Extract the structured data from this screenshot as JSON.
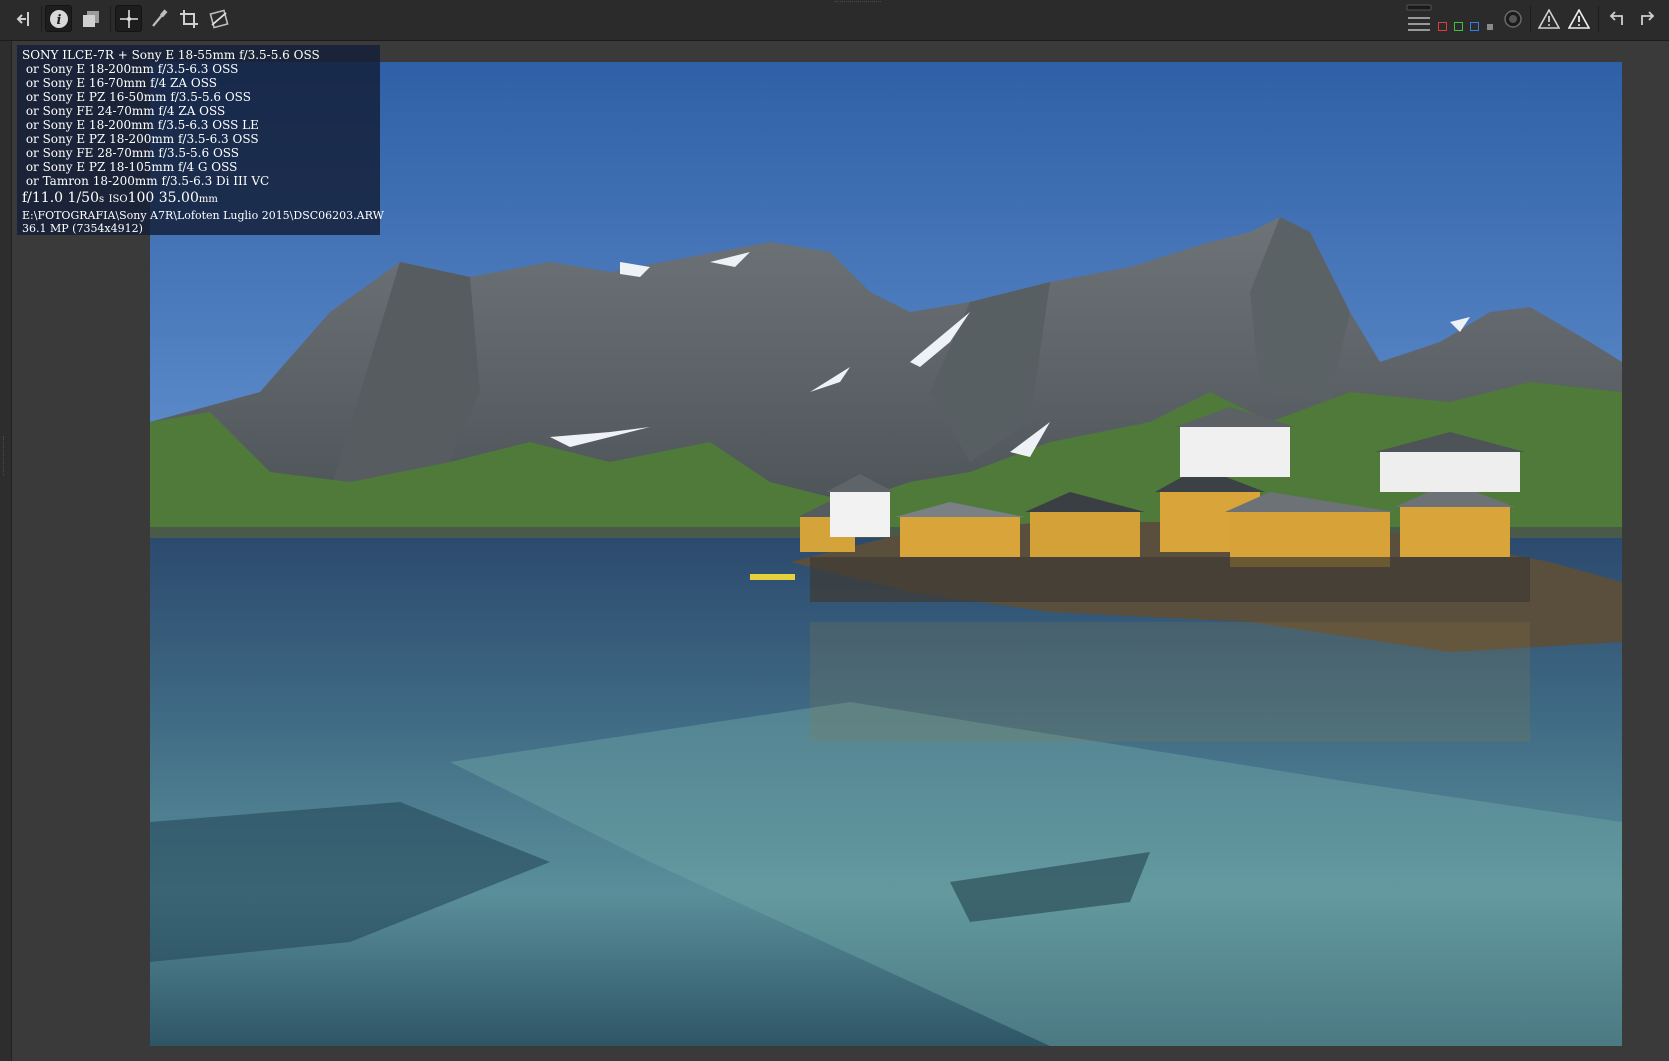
{
  "toolbar": {
    "left_buttons": [
      {
        "name": "hide-left-panel-button",
        "icon": "panel-collapse-left-icon"
      },
      {
        "name": "info-button",
        "icon": "info-icon",
        "pressed": true
      },
      {
        "name": "before-after-button",
        "icon": "before-after-icon"
      },
      {
        "name": "hand-tool-button",
        "icon": "move-cross-icon",
        "pressed": true
      },
      {
        "name": "white-balance-picker-button",
        "icon": "eyedropper-icon"
      },
      {
        "name": "crop-tool-button",
        "icon": "crop-icon"
      },
      {
        "name": "straighten-tool-button",
        "icon": "straighten-icon"
      }
    ],
    "right_buttons": [
      {
        "name": "focus-mask-button",
        "icon": "focus-mask-icon"
      },
      {
        "name": "red-channel-button",
        "icon": "red-square-icon",
        "color": "#e03a3a"
      },
      {
        "name": "green-channel-button",
        "icon": "green-square-icon",
        "color": "#3ec040"
      },
      {
        "name": "blue-channel-button",
        "icon": "blue-square-icon",
        "color": "#3a7ce0"
      },
      {
        "name": "luminance-channel-button",
        "icon": "gray-square-icon",
        "color": "#9a9a9a"
      },
      {
        "name": "preview-mode-button",
        "icon": "preview-circle-icon"
      },
      {
        "name": "shadow-clipping-button",
        "icon": "warning-triangle-icon"
      },
      {
        "name": "highlight-clipping-button",
        "icon": "warning-triangle-icon"
      },
      {
        "name": "rotate-left-button",
        "icon": "rotate-left-icon"
      },
      {
        "name": "rotate-right-button",
        "icon": "rotate-right-icon"
      }
    ]
  },
  "info": {
    "camera_line": "SONY ILCE-7R + Sony E 18-55mm f/3.5-5.6 OSS",
    "lens_alternatives": [
      " or Sony E 18-200mm f/3.5-6.3 OSS",
      " or Sony E 16-70mm f/4 ZA OSS",
      " or Sony E PZ 16-50mm f/3.5-5.6 OSS",
      " or Sony FE 24-70mm f/4 ZA OSS",
      " or Sony E 18-200mm f/3.5-6.3 OSS LE",
      " or Sony E PZ 18-200mm f/3.5-6.3 OSS",
      " or Sony FE 28-70mm f/3.5-5.6 OSS",
      " or Sony E PZ 18-105mm f/4 G OSS",
      " or Tamron 18-200mm f/3.5-6.3 Di III VC"
    ],
    "aperture": "f/11.0",
    "shutter": "1/50",
    "shutter_unit": "s",
    "iso_label": "ISO",
    "iso": "100",
    "focal": "35.00",
    "focal_unit": "mm",
    "path": "E:\\FOTOGRAFIA\\Sony A7R\\Lofoten Luglio 2015\\DSC06203.ARW",
    "megapixels": "36.1 MP (7354x4912)"
  },
  "colors": {
    "toolbar_bg": "#2b2b2b",
    "canvas_bg": "#3a3a3a",
    "overlay_bg": "#141e37"
  }
}
